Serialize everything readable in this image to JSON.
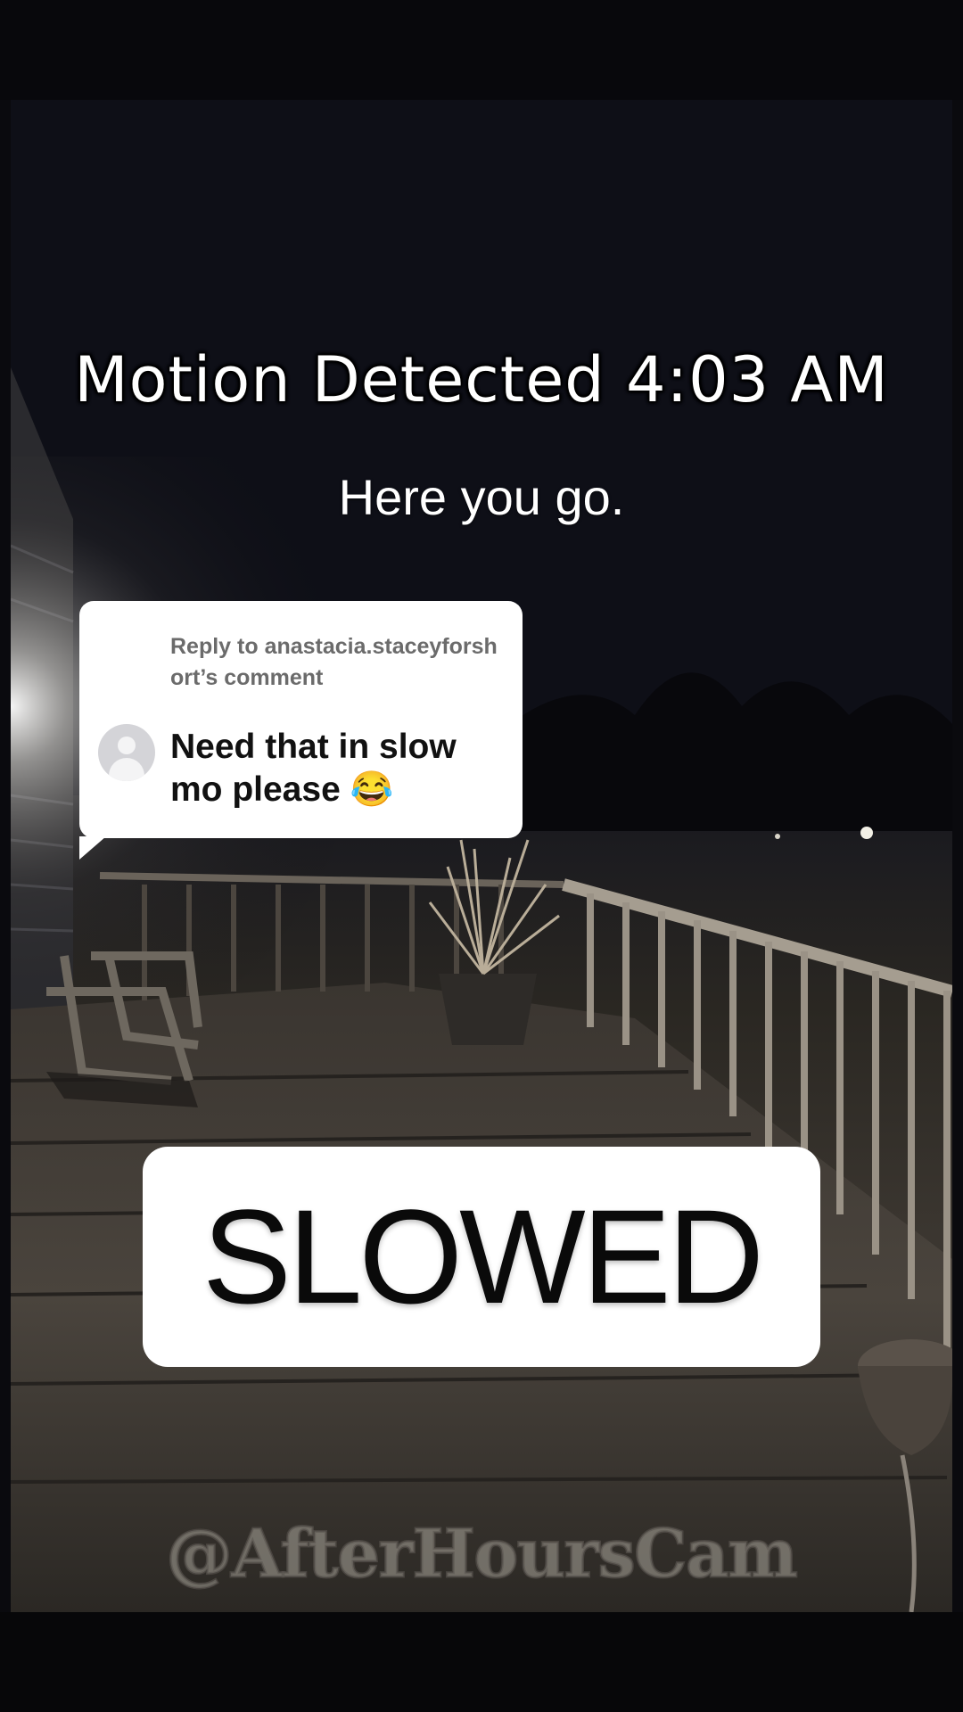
{
  "video": {
    "overlay_title": "Motion Detected 4:03 AM",
    "caption": "Here you go.",
    "label_box": "SLOWED",
    "watermark": "@AfterHoursCam"
  },
  "reply": {
    "label": "Reply to anastacia.staceyforshort’s comment",
    "text": "Need that in slow mo please 😂"
  },
  "colors": {
    "background": "#0a0a0e",
    "card": "#ffffff",
    "reply_label": "#6b6b6b"
  }
}
